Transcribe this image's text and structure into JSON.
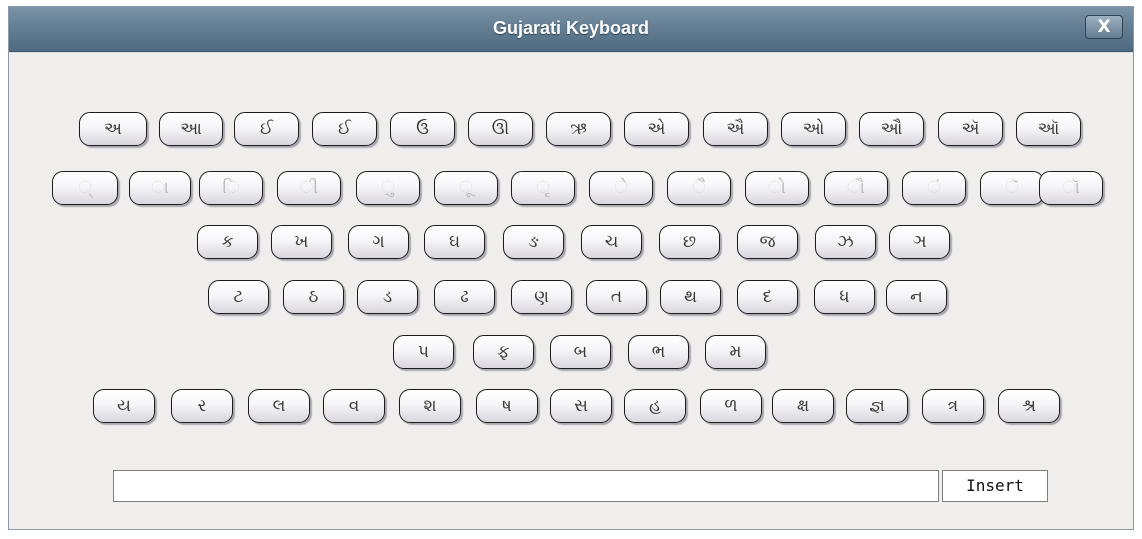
{
  "window": {
    "title": "Gujarati Keyboard",
    "close_label": "X"
  },
  "keyboard": {
    "rows": [
      [
        "અ",
        "આ",
        "ઈ",
        "ઈ",
        "ઉ",
        "ઊ",
        "ઋ",
        "એ",
        "ઐ",
        "ઓ",
        "ઔ",
        "ઍ",
        "ઑ"
      ],
      [
        "◌્",
        "◌ા",
        "◌િ",
        "◌ી",
        "◌ુ",
        "◌ૂ",
        "◌ૃ",
        "◌ે",
        "◌ૈ",
        "◌ો",
        "◌ૌ",
        "◌ં",
        "◌ૅ",
        "◌ૉ"
      ],
      [
        "ક",
        "ખ",
        "ગ",
        "ઘ",
        "ઙ",
        "ચ",
        "છ",
        "જ",
        "ઝ",
        "ઞ"
      ],
      [
        "ટ",
        "ઠ",
        "ડ",
        "ઢ",
        "ણ",
        "ત",
        "થ",
        "દ",
        "ધ",
        "ન"
      ],
      [
        "પ",
        "ફ",
        "બ",
        "ભ",
        "મ"
      ],
      [
        "ય",
        "ર",
        "લ",
        "વ",
        "શ",
        "ષ",
        "સ",
        "હ",
        "ળ",
        "ક્ષ",
        "જ્ઞ",
        "ત્ર",
        "શ્ર"
      ]
    ]
  },
  "input": {
    "value": "",
    "placeholder": ""
  },
  "insert_label": "Insert"
}
